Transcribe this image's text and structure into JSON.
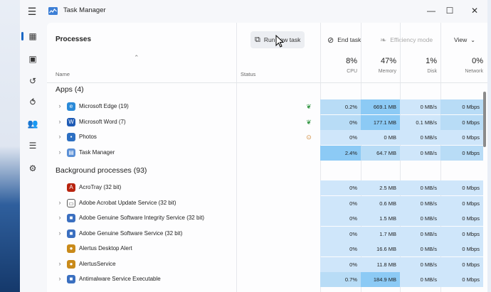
{
  "app": {
    "title": "Task Manager"
  },
  "window_controls": {
    "minimize": "—",
    "maximize": "☐",
    "close": "✕"
  },
  "nav": [
    {
      "icon": "processes-icon",
      "glyph": "▦"
    },
    {
      "icon": "performance-icon",
      "glyph": "▣"
    },
    {
      "icon": "app-history-icon",
      "glyph": "↺"
    },
    {
      "icon": "startup-apps-icon",
      "glyph": "⥀"
    },
    {
      "icon": "users-icon",
      "glyph": "👥"
    },
    {
      "icon": "details-icon",
      "glyph": "☰"
    },
    {
      "icon": "services-icon",
      "glyph": "⚙"
    }
  ],
  "toolbar": {
    "title": "Processes",
    "run_new_task": "Run new task",
    "end_task": "End task",
    "efficiency_mode": "Efficiency mode",
    "view": "View"
  },
  "columns": {
    "name": "Name",
    "status": "Status",
    "cpu": {
      "pct": "8%",
      "label": "CPU"
    },
    "memory": {
      "pct": "47%",
      "label": "Memory"
    },
    "disk": {
      "pct": "1%",
      "label": "Disk"
    },
    "network": {
      "pct": "0%",
      "label": "Network"
    }
  },
  "groups": [
    {
      "title": "Apps (4)",
      "rows": [
        {
          "name": "Microsoft Edge (19)",
          "icon": "edge-icon",
          "expand": true,
          "status_icon": "leaf-icon",
          "cpu": "0.2%",
          "memory": "669.1 MB",
          "disk": "0 MB/s",
          "network": "0 Mbps",
          "heat": {
            "cpu": 2,
            "memory": 3,
            "disk": 1,
            "network": 2
          }
        },
        {
          "name": "Microsoft Word (7)",
          "icon": "word-icon",
          "expand": true,
          "status_icon": "leaf-icon",
          "cpu": "0%",
          "memory": "177.1 MB",
          "disk": "0.1 MB/s",
          "network": "0 Mbps",
          "heat": {
            "cpu": 2,
            "memory": 3,
            "disk": 1,
            "network": 2
          }
        },
        {
          "name": "Photos",
          "icon": "photos-icon",
          "expand": true,
          "status_icon": "pause-icon",
          "cpu": "0%",
          "memory": "0 MB",
          "disk": "0 MB/s",
          "network": "0 Mbps",
          "heat": {
            "cpu": 1,
            "memory": 1,
            "disk": 1,
            "network": 1
          }
        },
        {
          "name": "Task Manager",
          "icon": "task-manager-icon",
          "expand": true,
          "status_icon": "",
          "cpu": "2.4%",
          "memory": "64.7 MB",
          "disk": "0 MB/s",
          "network": "0 Mbps",
          "heat": {
            "cpu": 3,
            "memory": 2,
            "disk": 1,
            "network": 2
          }
        }
      ]
    },
    {
      "title": "Background processes (93)",
      "rows": [
        {
          "name": "AcroTray (32 bit)",
          "icon": "acrotray-icon",
          "expand": false,
          "status_icon": "",
          "cpu": "0%",
          "memory": "2.5 MB",
          "disk": "0 MB/s",
          "network": "0 Mbps",
          "heat": {
            "cpu": 1,
            "memory": 1,
            "disk": 1,
            "network": 1
          }
        },
        {
          "name": "Adobe Acrobat Update Service (32 bit)",
          "icon": "window-icon",
          "expand": true,
          "status_icon": "",
          "cpu": "0%",
          "memory": "0.6 MB",
          "disk": "0 MB/s",
          "network": "0 Mbps",
          "heat": {
            "cpu": 1,
            "memory": 1,
            "disk": 1,
            "network": 1
          }
        },
        {
          "name": "Adobe Genuine Software Integrity Service (32 bit)",
          "icon": "service-icon",
          "expand": true,
          "status_icon": "",
          "cpu": "0%",
          "memory": "1.5 MB",
          "disk": "0 MB/s",
          "network": "0 Mbps",
          "heat": {
            "cpu": 1,
            "memory": 1,
            "disk": 1,
            "network": 1
          }
        },
        {
          "name": "Adobe Genuine Software Service (32 bit)",
          "icon": "service-icon",
          "expand": true,
          "status_icon": "",
          "cpu": "0%",
          "memory": "1.7 MB",
          "disk": "0 MB/s",
          "network": "0 Mbps",
          "heat": {
            "cpu": 1,
            "memory": 1,
            "disk": 1,
            "network": 1
          }
        },
        {
          "name": "Alertus Desktop Alert",
          "icon": "alertus-icon",
          "expand": false,
          "status_icon": "",
          "cpu": "0%",
          "memory": "16.6 MB",
          "disk": "0 MB/s",
          "network": "0 Mbps",
          "heat": {
            "cpu": 1,
            "memory": 1,
            "disk": 1,
            "network": 1
          }
        },
        {
          "name": "AlertusService",
          "icon": "alertus-icon",
          "expand": true,
          "status_icon": "",
          "cpu": "0%",
          "memory": "11.8 MB",
          "disk": "0 MB/s",
          "network": "0 Mbps",
          "heat": {
            "cpu": 1,
            "memory": 1,
            "disk": 1,
            "network": 1
          }
        },
        {
          "name": "Antimalware Service Executable",
          "icon": "service-icon",
          "expand": true,
          "status_icon": "",
          "cpu": "0.7%",
          "memory": "184.9 MB",
          "disk": "0 MB/s",
          "network": "0 Mbps",
          "heat": {
            "cpu": 2,
            "memory": 3,
            "disk": 1,
            "network": 1
          }
        }
      ]
    }
  ]
}
